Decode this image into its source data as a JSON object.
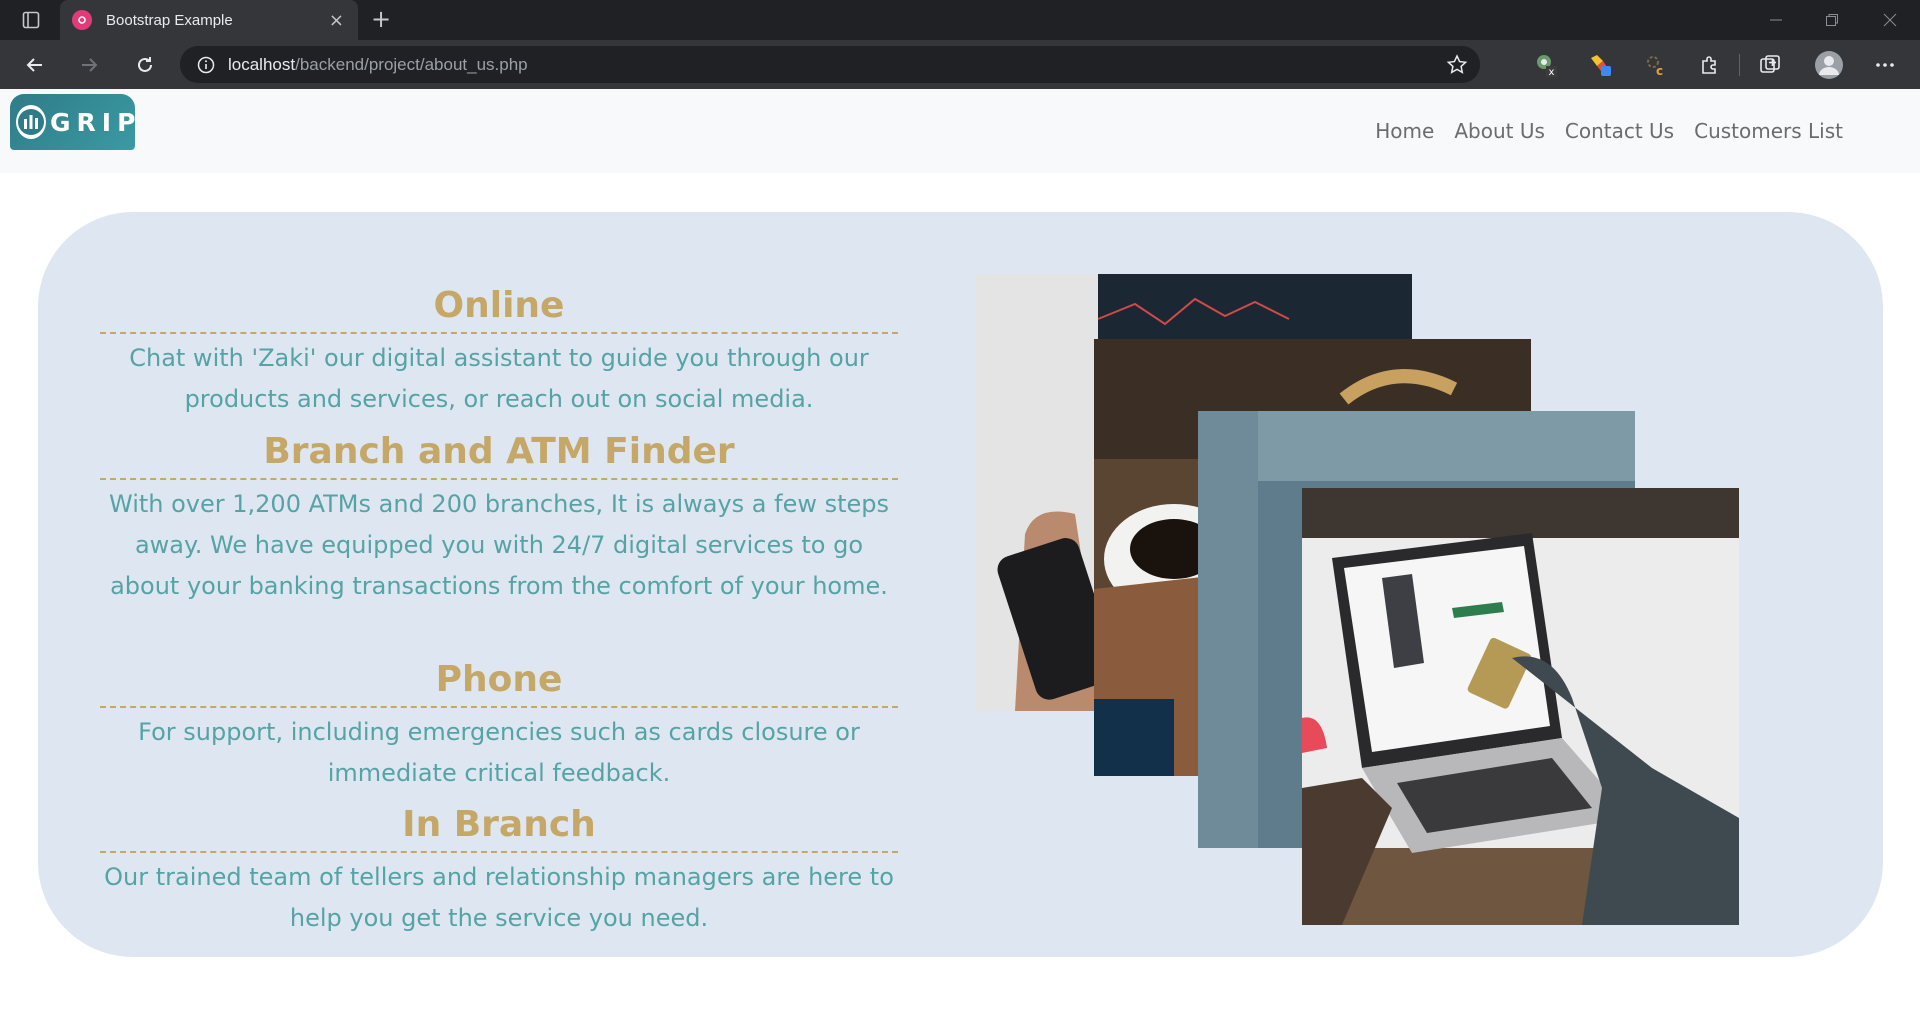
{
  "browser": {
    "tab_title": "Bootstrap Example",
    "tab_close": "×",
    "new_tab": "+",
    "url_host": "localhost",
    "url_path": "/backend/project/about_us.php"
  },
  "site": {
    "logo_text": "GRIP",
    "nav": [
      "Home",
      "About Us",
      "Contact Us",
      "Customers List"
    ]
  },
  "sections": [
    {
      "title": "Online",
      "body": "Chat with 'Zaki' our digital assistant to guide you through our products and services, or reach out on social media."
    },
    {
      "title": "Branch and ATM Finder",
      "body": "With over 1,200 ATMs and 200 branches, It is always a few steps away. We have equipped you with 24/7 digital services to go about your banking transactions from the comfort of your home."
    },
    {
      "title": "Phone",
      "body": "For support, including emergencies such as cards closure or immediate critical feedback."
    },
    {
      "title": "In Branch",
      "body": "Our trained team of tellers and relationship managers are here to help you get the service you need."
    }
  ],
  "colors": {
    "heading": "#c5a767",
    "body_text": "#56a3a6",
    "panel_bg": "#dee7f1",
    "nav_bg": "#f8f9fa",
    "logo_bg": "#2f7c88"
  }
}
